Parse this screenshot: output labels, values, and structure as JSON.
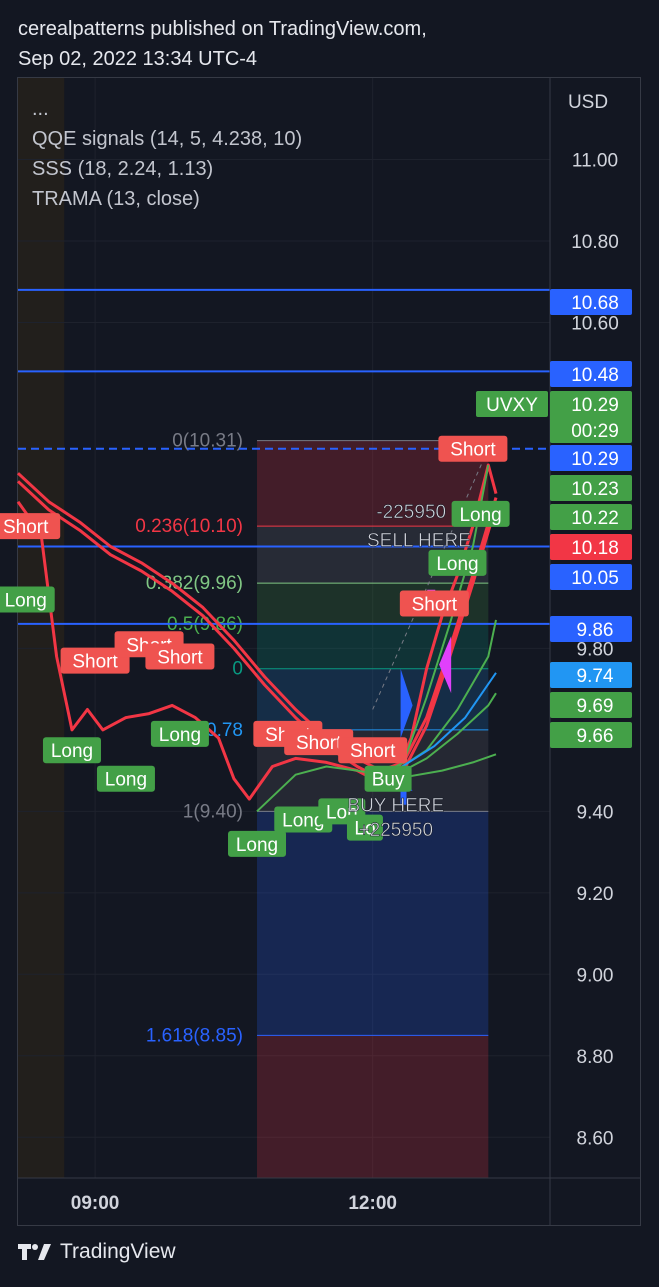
{
  "header": {
    "line1": "cerealpatterns published on TradingView.com,",
    "line2": "Sep 02, 2022 13:34 UTC-4"
  },
  "legend": {
    "dots": "...",
    "items": [
      "QQE signals (14, 5, 4.238, 10)",
      "SSS (18, 2.24, 1.13)",
      "TRAMA (13, close)"
    ]
  },
  "footer": {
    "brand": "TradingView"
  },
  "colors": {
    "bg": "#131722",
    "grid": "#1e222d",
    "red": "#f23645",
    "green": "#4caf50",
    "blue": "#2962ff",
    "short_label": "#ef5350",
    "long_label": "#43a047"
  },
  "chart_data": {
    "type": "line",
    "currency": "USD",
    "ylim": [
      8.5,
      11.2
    ],
    "y_ticks": [
      "11.00",
      "10.80",
      "10.60",
      "9.80",
      "9.40",
      "9.20",
      "9.00",
      "8.80",
      "8.60"
    ],
    "x_ticks": [
      {
        "label": "09:00",
        "t": "09:00"
      },
      {
        "label": "12:00",
        "t": "12:00"
      }
    ],
    "xlim": [
      "08:10",
      "13:55"
    ],
    "symbol": "UVXY",
    "price_badges": [
      {
        "value": "10.68",
        "color": "#2962ff"
      },
      {
        "value": "10.48",
        "color": "#2962ff"
      },
      {
        "value": "10.29",
        "sub": "00:29",
        "color": "#43a047"
      },
      {
        "value": "10.29",
        "color": "#2962ff"
      },
      {
        "value": "10.23",
        "color": "#43a047"
      },
      {
        "value": "10.22",
        "color": "#43a047"
      },
      {
        "value": "10.18",
        "color": "#f23645"
      },
      {
        "value": "10.05",
        "color": "#2962ff"
      },
      {
        "value": "9.86",
        "color": "#2962ff"
      },
      {
        "value": "9.74",
        "color": "#2196f3"
      },
      {
        "value": "9.69",
        "color": "#43a047"
      },
      {
        "value": "9.66",
        "color": "#43a047"
      }
    ],
    "horizontal_lines": [
      10.68,
      10.48,
      10.05,
      9.86
    ],
    "dashed_line": 10.29,
    "fib": {
      "t_start": "10:45",
      "t_end": "13:15",
      "levels": [
        {
          "label": "0(10.31)",
          "value": 10.31,
          "color": "#787b86"
        },
        {
          "label": "0.236(10.10)",
          "value": 10.1,
          "color": "#f23645"
        },
        {
          "label": "0.382(9.96)",
          "value": 9.96,
          "color": "#81c784"
        },
        {
          "label": "0.5(9.86)",
          "value": 9.86,
          "color": "#4caf50"
        },
        {
          "label": "0",
          "value": 9.75,
          "color": "#089981"
        },
        {
          "label": "0.78",
          "value": 9.6,
          "color": "#2196f3"
        },
        {
          "label": "1(9.40)",
          "value": 9.4,
          "color": "#787b86"
        },
        {
          "label": "1.618(8.85)",
          "value": 8.85,
          "color": "#2962ff"
        }
      ]
    },
    "series": [
      {
        "color": "#f23645",
        "points": [
          [
            "08:10",
            10.23
          ],
          [
            "08:30",
            10.16
          ],
          [
            "08:50",
            10.11
          ],
          [
            "09:10",
            10.05
          ],
          [
            "09:30",
            10.01
          ],
          [
            "09:50",
            9.96
          ],
          [
            "10:10",
            9.9
          ],
          [
            "10:30",
            9.82
          ],
          [
            "10:50",
            9.73
          ],
          [
            "11:10",
            9.65
          ],
          [
            "11:30",
            9.58
          ],
          [
            "11:50",
            9.53
          ],
          [
            "12:05",
            9.5
          ],
          [
            "12:20",
            9.52
          ],
          [
            "12:35",
            9.63
          ],
          [
            "12:50",
            9.8
          ],
          [
            "13:05",
            9.98
          ],
          [
            "13:20",
            10.17
          ]
        ]
      },
      {
        "color": "#f23645",
        "points": [
          [
            "08:10",
            10.21
          ],
          [
            "08:30",
            10.14
          ],
          [
            "08:50",
            10.09
          ],
          [
            "09:10",
            10.03
          ],
          [
            "09:30",
            9.99
          ],
          [
            "09:50",
            9.94
          ],
          [
            "10:10",
            9.88
          ],
          [
            "10:30",
            9.8
          ],
          [
            "10:50",
            9.71
          ],
          [
            "11:10",
            9.63
          ],
          [
            "11:30",
            9.56
          ],
          [
            "11:50",
            9.51
          ],
          [
            "12:05",
            9.48
          ],
          [
            "12:20",
            9.5
          ],
          [
            "12:35",
            9.61
          ],
          [
            "12:50",
            9.78
          ],
          [
            "13:05",
            9.96
          ],
          [
            "13:20",
            10.15
          ]
        ]
      },
      {
        "color": "#f23645",
        "points": [
          [
            "08:10",
            10.16
          ],
          [
            "08:25",
            10.08
          ],
          [
            "08:35",
            9.78
          ],
          [
            "08:45",
            9.6
          ],
          [
            "08:55",
            9.65
          ],
          [
            "09:05",
            9.6
          ],
          [
            "09:20",
            9.63
          ],
          [
            "09:35",
            9.64
          ],
          [
            "09:50",
            9.66
          ],
          [
            "10:05",
            9.63
          ],
          [
            "10:20",
            9.58
          ],
          [
            "10:30",
            9.48
          ],
          [
            "10:40",
            9.43
          ],
          [
            "10:55",
            9.51
          ],
          [
            "11:10",
            9.53
          ],
          [
            "11:30",
            9.52
          ],
          [
            "11:50",
            9.5
          ],
          [
            "12:05",
            9.47
          ],
          [
            "12:15",
            9.49
          ],
          [
            "12:25",
            9.58
          ],
          [
            "12:35",
            9.75
          ],
          [
            "12:45",
            9.88
          ],
          [
            "12:55",
            9.98
          ],
          [
            "13:05",
            10.1
          ],
          [
            "13:15",
            10.25
          ],
          [
            "13:20",
            10.18
          ]
        ]
      },
      {
        "color": "#4caf50",
        "points": [
          [
            "10:45",
            9.4
          ],
          [
            "11:10",
            9.49
          ],
          [
            "11:30",
            9.51
          ],
          [
            "11:50",
            9.5
          ],
          [
            "12:05",
            9.49
          ],
          [
            "12:20",
            9.52
          ],
          [
            "12:35",
            9.68
          ],
          [
            "12:50",
            9.86
          ],
          [
            "13:05",
            10.05
          ],
          [
            "13:15",
            10.25
          ]
        ]
      },
      {
        "color": "#4caf50",
        "points": [
          [
            "12:15",
            9.5
          ],
          [
            "12:35",
            9.55
          ],
          [
            "12:55",
            9.65
          ],
          [
            "13:15",
            9.78
          ],
          [
            "13:20",
            9.87
          ]
        ]
      },
      {
        "color": "#4caf50",
        "points": [
          [
            "12:15",
            9.49
          ],
          [
            "12:35",
            9.53
          ],
          [
            "12:55",
            9.59
          ],
          [
            "13:15",
            9.66
          ],
          [
            "13:20",
            9.69
          ]
        ]
      },
      {
        "color": "#4caf50",
        "points": [
          [
            "12:15",
            9.48
          ],
          [
            "12:45",
            9.5
          ],
          [
            "13:05",
            9.52
          ],
          [
            "13:20",
            9.54
          ]
        ]
      },
      {
        "color": "#2196f3",
        "points": [
          [
            "12:15",
            9.5
          ],
          [
            "12:40",
            9.56
          ],
          [
            "13:00",
            9.63
          ],
          [
            "13:20",
            9.74
          ]
        ]
      }
    ],
    "signals": [
      {
        "text": "Short",
        "type": "short",
        "t": "08:15",
        "y": 10.1
      },
      {
        "text": "Long",
        "type": "long",
        "t": "08:15",
        "y": 9.92
      },
      {
        "text": "Short",
        "type": "short",
        "t": "09:00",
        "y": 9.77
      },
      {
        "text": "Short",
        "type": "short",
        "t": "09:35",
        "y": 9.81
      },
      {
        "text": "Short",
        "type": "short",
        "t": "09:55",
        "y": 9.78
      },
      {
        "text": "Long",
        "type": "long",
        "t": "08:45",
        "y": 9.55
      },
      {
        "text": "Long",
        "type": "long",
        "t": "09:20",
        "y": 9.48
      },
      {
        "text": "Long",
        "type": "long",
        "t": "09:55",
        "y": 9.59
      },
      {
        "text": "Short",
        "type": "short",
        "t": "11:05",
        "y": 9.59
      },
      {
        "text": "Short",
        "type": "short",
        "t": "11:25",
        "y": 9.57
      },
      {
        "text": "Short",
        "type": "short",
        "t": "12:00",
        "y": 9.55
      },
      {
        "text": "Long",
        "type": "long",
        "t": "10:45",
        "y": 9.32
      },
      {
        "text": "Long",
        "type": "long",
        "t": "11:15",
        "y": 9.38
      },
      {
        "text": "Lon",
        "type": "long",
        "t": "11:40",
        "y": 9.4
      },
      {
        "text": "Lo",
        "type": "long",
        "t": "11:55",
        "y": 9.36
      },
      {
        "text": "Buy",
        "type": "long",
        "t": "12:10",
        "y": 9.48
      },
      {
        "text": "Short",
        "type": "short",
        "t": "12:40",
        "y": 9.91
      },
      {
        "text": "Long",
        "type": "long",
        "t": "12:55",
        "y": 10.01
      },
      {
        "text": "Long",
        "type": "long",
        "t": "13:10",
        "y": 10.13
      },
      {
        "text": "Short",
        "type": "short",
        "t": "13:05",
        "y": 10.29
      }
    ],
    "annotations": [
      {
        "text": "-225950",
        "t": "12:25",
        "y": 10.12
      },
      {
        "text": "SELL HERE",
        "t": "12:30",
        "y": 10.05
      },
      {
        "text": "BUY HERE",
        "t": "12:15",
        "y": 9.4
      },
      {
        "text": "+225950",
        "t": "12:15",
        "y": 9.34
      }
    ]
  }
}
